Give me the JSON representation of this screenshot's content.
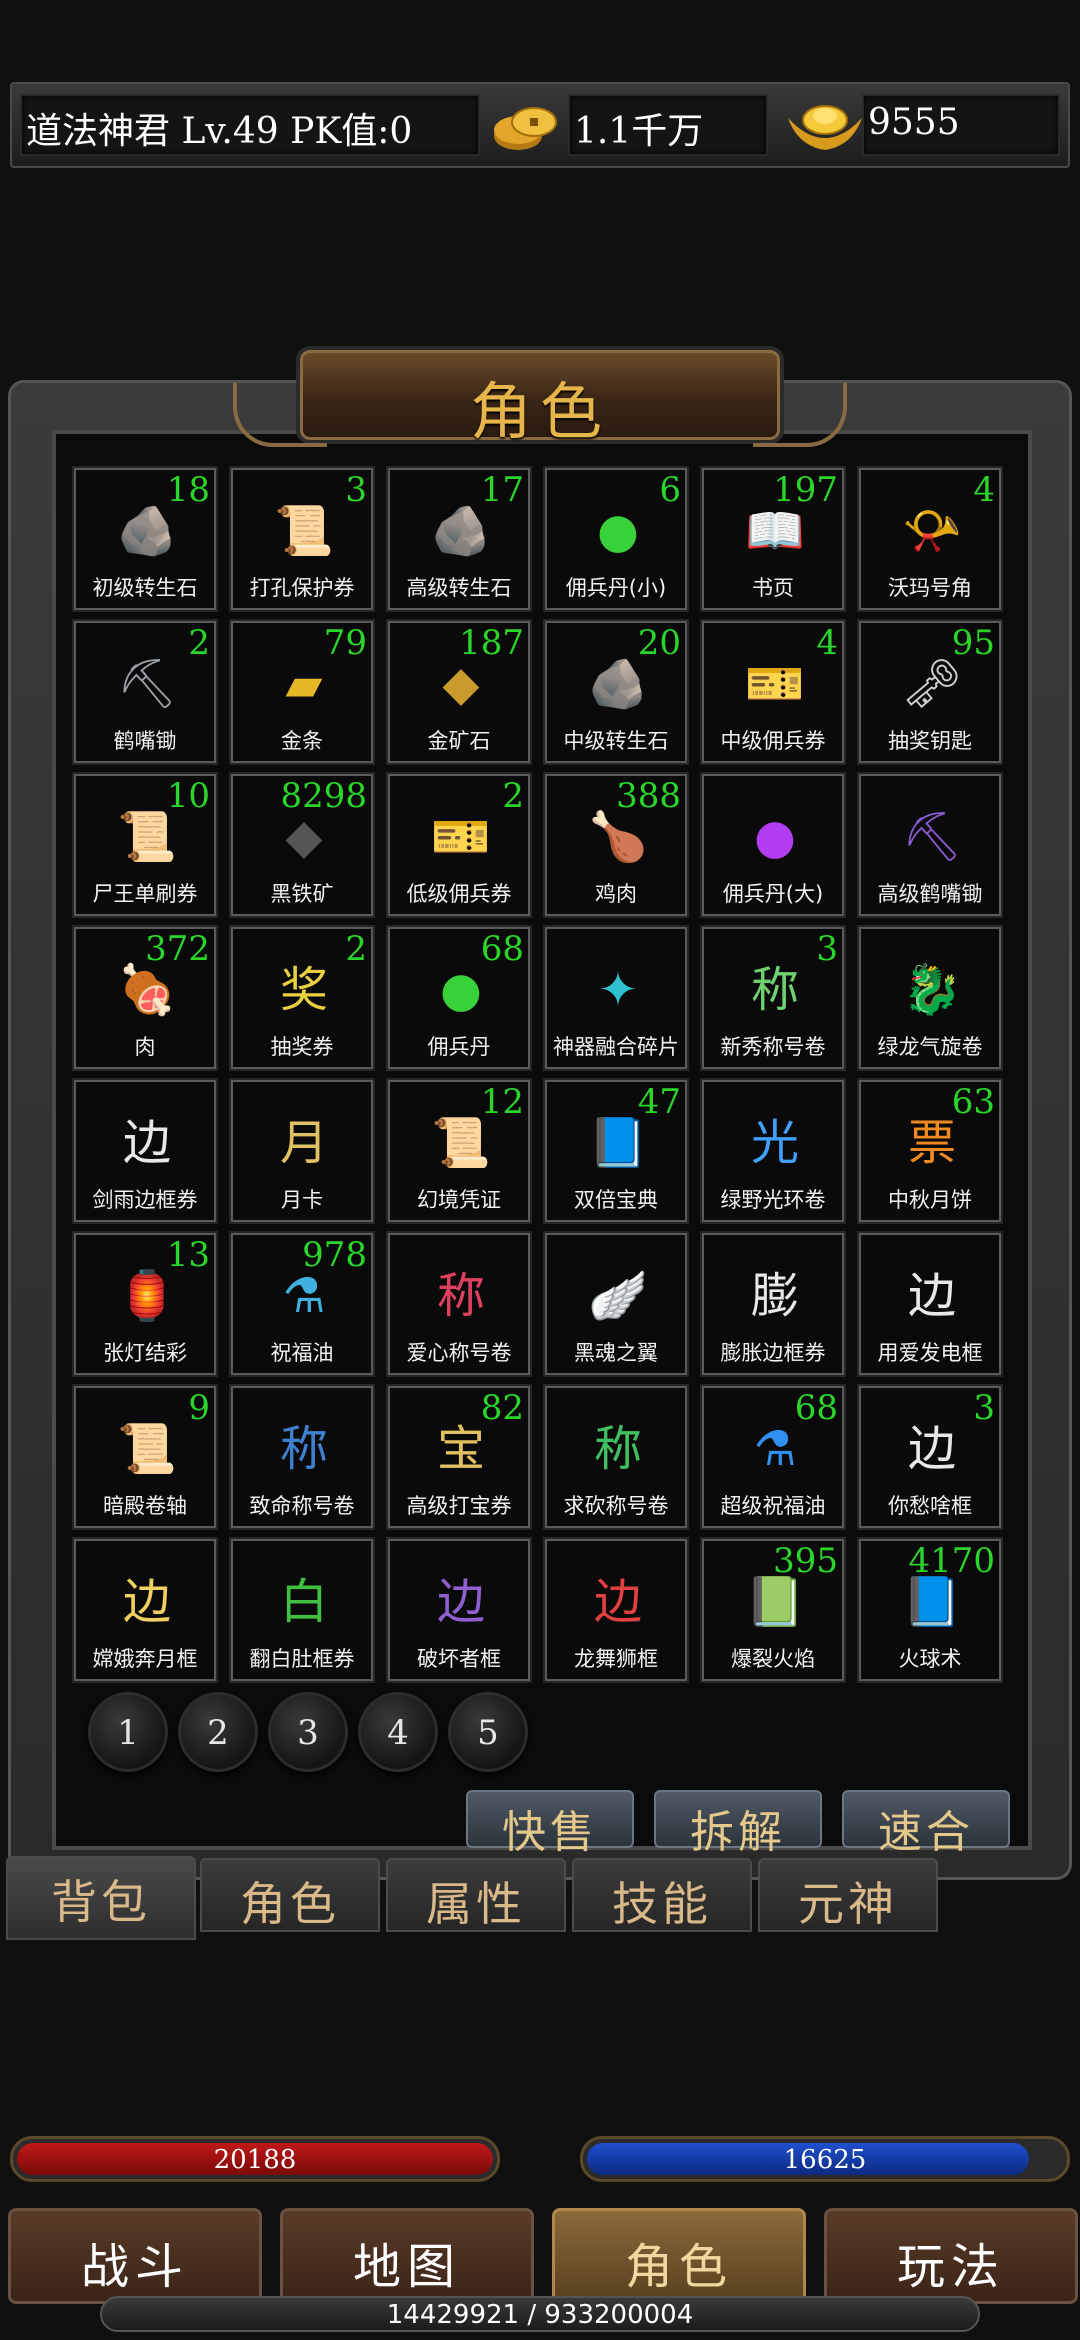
{
  "player": {
    "info": "道法神君  Lv.49 PK值:0",
    "gold": "1.1千万",
    "ingot": "9555"
  },
  "panel": {
    "title": "角色"
  },
  "items": [
    {
      "name": "初级转生石",
      "count": "18",
      "icon": "rune-stone-icon",
      "glyph": "🪨",
      "color": "#cfcfcf"
    },
    {
      "name": "打孔保护券",
      "count": "3",
      "icon": "blue-scroll-icon",
      "glyph": "📜",
      "color": "#6fc3ff"
    },
    {
      "name": "高级转生石",
      "count": "17",
      "icon": "rune-stone-icon",
      "glyph": "🪨",
      "color": "#d8c070"
    },
    {
      "name": "佣兵丹(小)",
      "count": "6",
      "icon": "green-orb-icon",
      "glyph": "●",
      "color": "#39d139"
    },
    {
      "name": "书页",
      "count": "197",
      "icon": "book-icon",
      "glyph": "📖",
      "color": "#c89860"
    },
    {
      "name": "沃玛号角",
      "count": "4",
      "icon": "horn-icon",
      "glyph": "📯",
      "color": "#c4955a"
    },
    {
      "name": "鹤嘴锄",
      "count": "2",
      "icon": "pickaxe-icon",
      "glyph": "⛏",
      "color": "#9aa0a6"
    },
    {
      "name": "金条",
      "count": "79",
      "icon": "gold-bar-icon",
      "glyph": "▰",
      "color": "#e5b82a"
    },
    {
      "name": "金矿石",
      "count": "187",
      "icon": "gold-ore-icon",
      "glyph": "◆",
      "color": "#c99a2c"
    },
    {
      "name": "中级转生石",
      "count": "20",
      "icon": "rune-stone-icon",
      "glyph": "🪨",
      "color": "#8fb0ff"
    },
    {
      "name": "中级佣兵券",
      "count": "4",
      "icon": "blue-ticket-icon",
      "glyph": "🎫",
      "color": "#4aa3ff"
    },
    {
      "name": "抽奖钥匙",
      "count": "95",
      "icon": "key-icon",
      "glyph": "🗝",
      "color": "#d0d0d0"
    },
    {
      "name": "尸王单刷券",
      "count": "10",
      "icon": "scroll-icon",
      "glyph": "📜",
      "color": "#e0c080"
    },
    {
      "name": "黑铁矿",
      "count": "8298",
      "icon": "black-ore-icon",
      "glyph": "◆",
      "color": "#555555"
    },
    {
      "name": "低级佣兵券",
      "count": "2",
      "icon": "green-ticket-icon",
      "glyph": "🎫",
      "color": "#5fd15f"
    },
    {
      "name": "鸡肉",
      "count": "388",
      "icon": "chicken-icon",
      "glyph": "🍗",
      "color": "#d0a060"
    },
    {
      "name": "佣兵丹(大)",
      "count": "",
      "icon": "purple-orb-icon",
      "glyph": "●",
      "color": "#b23cf0"
    },
    {
      "name": "高级鹤嘴锄",
      "count": "",
      "icon": "pickaxe-icon",
      "glyph": "⛏",
      "color": "#8a5ad0"
    },
    {
      "name": "肉",
      "count": "372",
      "icon": "meat-icon",
      "glyph": "🍖",
      "color": "#d97b6a"
    },
    {
      "name": "抽奖券",
      "count": "2",
      "icon": "lottery-ticket-icon",
      "glyph": "奖",
      "color": "#e8d040"
    },
    {
      "name": "佣兵丹",
      "count": "68",
      "icon": "green-orb-icon",
      "glyph": "●",
      "color": "#39d139"
    },
    {
      "name": "神器融合碎片",
      "count": "",
      "icon": "crystal-shard-icon",
      "glyph": "✦",
      "color": "#30c0d0"
    },
    {
      "name": "新秀称号卷",
      "count": "3",
      "icon": "title-card-icon",
      "glyph": "称",
      "color": "#6fd06f"
    },
    {
      "name": "绿龙气旋卷",
      "count": "",
      "icon": "dragon-icon",
      "glyph": "🐉",
      "color": "#3fcf3f"
    },
    {
      "name": "剑雨边框券",
      "count": "",
      "icon": "frame-ticket-icon",
      "glyph": "边",
      "color": "#e8e8e8"
    },
    {
      "name": "月卡",
      "count": "",
      "icon": "month-card-icon",
      "glyph": "月",
      "color": "#e0c060"
    },
    {
      "name": "幻境凭证",
      "count": "12",
      "icon": "red-scroll-icon",
      "glyph": "📜",
      "color": "#d04040"
    },
    {
      "name": "双倍宝典",
      "count": "47",
      "icon": "double-book-icon",
      "glyph": "📘",
      "color": "#6f8fd0"
    },
    {
      "name": "绿野光环卷",
      "count": "",
      "icon": "halo-card-icon",
      "glyph": "光",
      "color": "#3fa0ff"
    },
    {
      "name": "中秋月饼",
      "count": "63",
      "icon": "mooncake-icon",
      "glyph": "票",
      "color": "#f08a20"
    },
    {
      "name": "张灯结彩",
      "count": "13",
      "icon": "lantern-icon",
      "glyph": "🏮",
      "color": "#e04020"
    },
    {
      "name": "祝福油",
      "count": "978",
      "icon": "potion-icon",
      "glyph": "⚗",
      "color": "#40b0e0"
    },
    {
      "name": "爱心称号卷",
      "count": "",
      "icon": "title-card-icon",
      "glyph": "称",
      "color": "#e04060"
    },
    {
      "name": "黑魂之翼",
      "count": "",
      "icon": "wings-icon",
      "glyph": "🪽",
      "color": "#404060"
    },
    {
      "name": "膨胀边框券",
      "count": "",
      "icon": "frame-ticket-icon",
      "glyph": "膨",
      "color": "#e8e8e8"
    },
    {
      "name": "用爱发电框",
      "count": "",
      "icon": "frame-ticket-icon",
      "glyph": "边",
      "color": "#e8e8e8"
    },
    {
      "name": "暗殿卷轴",
      "count": "9",
      "icon": "rolled-scroll-icon",
      "glyph": "📜",
      "color": "#a07050"
    },
    {
      "name": "致命称号卷",
      "count": "",
      "icon": "title-card-icon",
      "glyph": "称",
      "color": "#4080d0"
    },
    {
      "name": "高级打宝券",
      "count": "82",
      "icon": "treasure-scroll-icon",
      "glyph": "宝",
      "color": "#e0c060"
    },
    {
      "name": "求砍称号卷",
      "count": "",
      "icon": "title-card-icon",
      "glyph": "称",
      "color": "#40c060"
    },
    {
      "name": "超级祝福油",
      "count": "68",
      "icon": "potion-icon",
      "glyph": "⚗",
      "color": "#3090f0"
    },
    {
      "name": "你愁啥框",
      "count": "3",
      "icon": "frame-ticket-icon",
      "glyph": "边",
      "color": "#e8e8e8"
    },
    {
      "name": "嫦娥奔月框",
      "count": "",
      "icon": "frame-ticket-icon",
      "glyph": "边",
      "color": "#f0d060"
    },
    {
      "name": "翻白肚框券",
      "count": "",
      "icon": "frog-frame-icon",
      "glyph": "白",
      "color": "#40c040"
    },
    {
      "name": "破坏者框",
      "count": "",
      "icon": "frame-ticket-icon",
      "glyph": "边",
      "color": "#9060d0"
    },
    {
      "name": "龙舞狮框",
      "count": "",
      "icon": "frame-ticket-icon",
      "glyph": "边",
      "color": "#e04040"
    },
    {
      "name": "爆裂火焰",
      "count": "395",
      "icon": "skill-book-icon",
      "glyph": "📗",
      "color": "#8a8a50"
    },
    {
      "name": "火球术",
      "count": "4170",
      "icon": "skill-book-icon",
      "glyph": "📘",
      "color": "#60a0b0"
    }
  ],
  "pages": [
    "1",
    "2",
    "3",
    "4",
    "5"
  ],
  "actions": [
    "快售",
    "拆解",
    "速合"
  ],
  "panel_tabs": [
    "背包",
    "角色",
    "属性",
    "技能",
    "元神"
  ],
  "hp": {
    "value": "20188",
    "fill": 1.0,
    "color": "#c01818"
  },
  "mp": {
    "value": "16625",
    "fill": 0.93,
    "color": "#2050d0"
  },
  "nav": [
    "战斗",
    "地图",
    "角色",
    "玩法"
  ],
  "exp": {
    "text": "14429921 / 933200004"
  }
}
